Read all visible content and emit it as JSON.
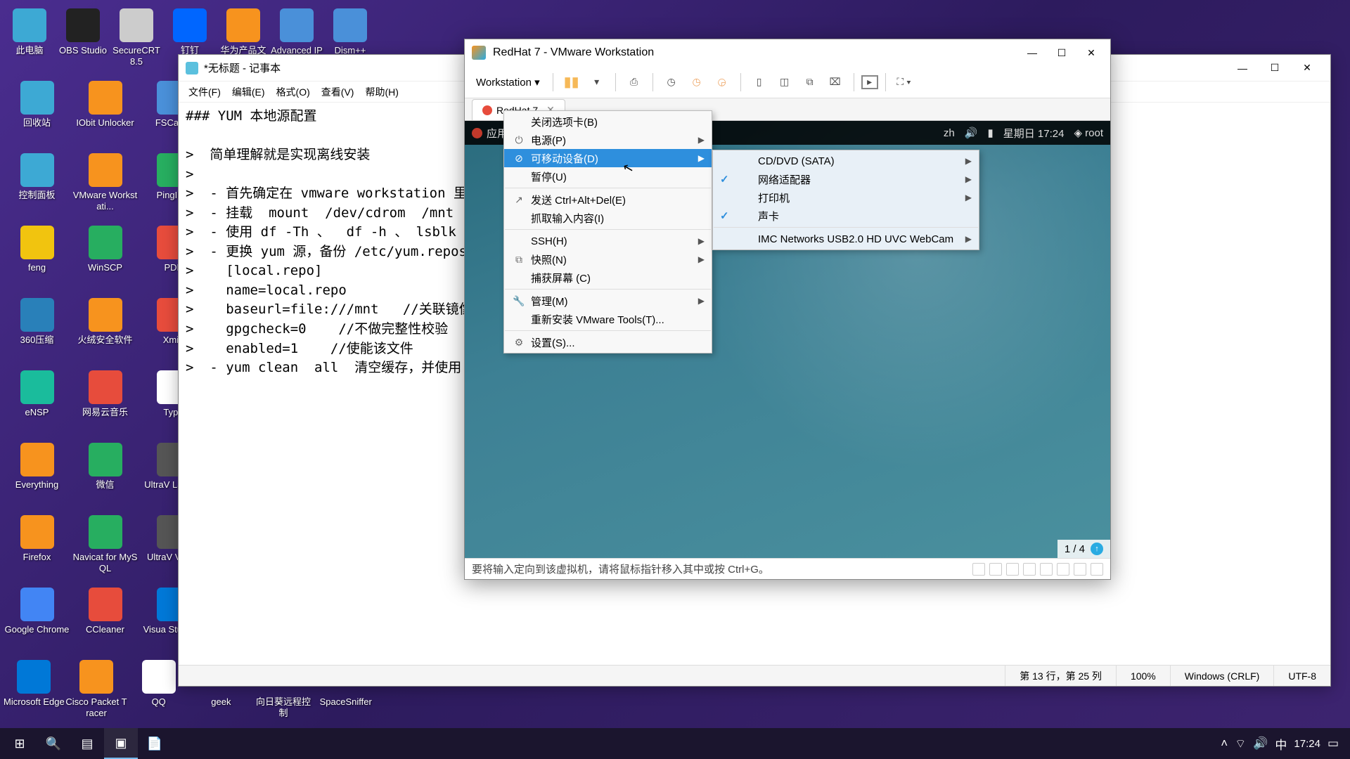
{
  "desktop_icons": [
    [
      {
        "l": "此电脑",
        "c": "#3da9d4"
      },
      {
        "l": "OBS Studio",
        "c": "#222"
      },
      {
        "l": "SecureCRT 8.5",
        "c": "#ccc"
      },
      {
        "l": "钉钉",
        "c": "#06f"
      },
      {
        "l": "华为产品文档",
        "c": "#f7931e"
      },
      {
        "l": "Advanced IP",
        "c": "#4a90d9"
      },
      {
        "l": "Dism++",
        "c": "#4a90d9"
      }
    ],
    [
      {
        "l": "回收站",
        "c": "#3da9d4"
      },
      {
        "l": "IObit Unlocker",
        "c": "#f7931e"
      },
      {
        "l": "FSCaptu",
        "c": "#4a90d9"
      }
    ],
    [
      {
        "l": "控制面板",
        "c": "#3da9d4"
      },
      {
        "l": "VMware Workstati...",
        "c": "#f7931e"
      },
      {
        "l": "PingInfo",
        "c": "#27ae60"
      }
    ],
    [
      {
        "l": "feng",
        "c": "#f1c40f"
      },
      {
        "l": "WinSCP",
        "c": "#27ae60"
      },
      {
        "l": "PDF",
        "c": "#e74c3c"
      }
    ],
    [
      {
        "l": "360压缩",
        "c": "#2980b9"
      },
      {
        "l": "火绒安全软件",
        "c": "#f7931e"
      },
      {
        "l": "Xmin",
        "c": "#e74c3c"
      }
    ],
    [
      {
        "l": "eNSP",
        "c": "#1abc9c"
      },
      {
        "l": "网易云音乐",
        "c": "#e74c3c"
      },
      {
        "l": "Typo",
        "c": "#fff"
      }
    ],
    [
      {
        "l": "Everything",
        "c": "#f7931e"
      },
      {
        "l": "微信",
        "c": "#27ae60"
      },
      {
        "l": "UltraV Launch",
        "c": "#555"
      }
    ],
    [
      {
        "l": "Firefox",
        "c": "#f7931e"
      },
      {
        "l": "Navicat for MySQL",
        "c": "#27ae60"
      },
      {
        "l": "UltraV Viewe",
        "c": "#555"
      }
    ],
    [
      {
        "l": "Google Chrome",
        "c": "#4285f4"
      },
      {
        "l": "CCleaner",
        "c": "#e74c3c"
      },
      {
        "l": "Visua Studio C",
        "c": "#0078d7"
      }
    ],
    [
      {
        "l": "Microsoft Edge",
        "c": "#0078d7"
      },
      {
        "l": "Cisco Packet Tracer",
        "c": "#f7931e"
      },
      {
        "l": "QQ",
        "c": "#fff"
      },
      {
        "l": "geek",
        "c": ""
      },
      {
        "l": "向日葵远程控制",
        "c": ""
      },
      {
        "l": "SpaceSniffer",
        "c": ""
      }
    ]
  ],
  "notepad": {
    "title": "*无标题 - 记事本",
    "menu": [
      "文件(F)",
      "编辑(E)",
      "格式(O)",
      "查看(V)",
      "帮助(H)"
    ],
    "body": "### YUM 本地源配置\n\n>  简单理解就是实现离线安装\n>\n>  - 首先确定在 vmware workstation 里面镜\n>  - 挂载  mount  /dev/cdrom  /mnt  将镜像\n>  - 使用 df -Th 、  df -h 、 lsblk 进行查看挂\n>  - 更换 yum 源，备份 /etc/yum.repos.d 目\n>    [local.repo]\n>    name=local.repo\n>    baseurl=file:///mnt   //关联镜像挂载点\n>    gpgcheck=0    //不做完整性校验\n>    enabled=1    //使能该文件\n>  - yum clean  all  清空缓存，并使用  yum",
    "status": {
      "pos": "第 13 行，第 25 列",
      "zoom": "100%",
      "eol": "Windows (CRLF)",
      "enc": "UTF-8"
    }
  },
  "vmware": {
    "title": "RedHat 7 - VMware Workstation",
    "ws_label": "Workstation  ▾",
    "tab": "RedHat 7",
    "gnome": {
      "app": "应用",
      "lang": "zh",
      "date": "星期日 17:24",
      "user": "root"
    },
    "pager": "1  /  4",
    "hint": "要将输入定向到该虚拟机，请将鼠标指针移入其中或按 Ctrl+G。"
  },
  "ctx1": [
    {
      "t": "关闭选项卡(B)",
      "i": ""
    },
    {
      "t": "电源(P)",
      "i": "⏻",
      "sub": true
    },
    {
      "t": "可移动设备(D)",
      "i": "⊘",
      "sub": true,
      "hl": true
    },
    {
      "t": "暂停(U)",
      "i": ""
    },
    {
      "sep": true
    },
    {
      "t": "发送 Ctrl+Alt+Del(E)",
      "i": "↗"
    },
    {
      "t": "抓取输入内容(I)",
      "i": ""
    },
    {
      "sep": true
    },
    {
      "t": "SSH(H)",
      "i": "",
      "sub": true
    },
    {
      "t": "快照(N)",
      "i": "⧉",
      "sub": true
    },
    {
      "t": "捕获屏幕 (C)",
      "i": ""
    },
    {
      "sep": true
    },
    {
      "t": "管理(M)",
      "i": "🔧",
      "sub": true
    },
    {
      "t": "重新安装 VMware Tools(T)...",
      "i": ""
    },
    {
      "sep": true
    },
    {
      "t": "设置(S)...",
      "i": "⚙"
    }
  ],
  "ctx2": [
    {
      "t": "CD/DVD (SATA)",
      "sub": true
    },
    {
      "t": "网络适配器",
      "chk": true,
      "sub": true
    },
    {
      "t": "打印机",
      "sub": true
    },
    {
      "t": "声卡",
      "chk": true
    },
    {
      "sep": true
    },
    {
      "t": "IMC Networks USB2.0 HD UVC WebCam",
      "sub": true
    }
  ],
  "taskbar": {
    "time": "17:24",
    "ime": "中"
  }
}
